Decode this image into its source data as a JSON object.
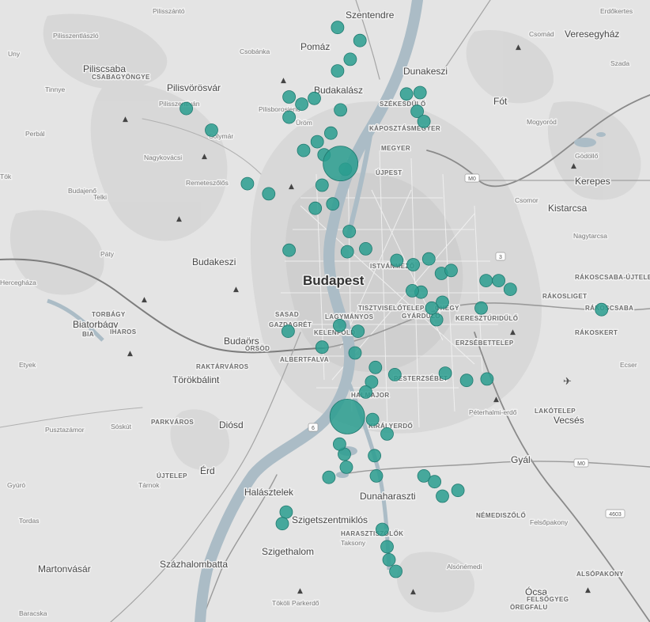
{
  "map": {
    "marker_color": "#2a9d8f",
    "water_color": "#abbcc6",
    "capital": "Budapest",
    "places_major": [
      "Szentendre",
      "Pomáz",
      "Dunakeszi",
      "Budakalász",
      "Veresegyház",
      "Fót",
      "Piliscsaba",
      "Pilisvörösvár",
      "Kerepes",
      "Kistarcsa",
      "Budakeszi",
      "Biatorbágy",
      "Budaörs",
      "Törökbálint",
      "Diósd",
      "Érd",
      "Vecsés",
      "Gyál",
      "Halásztelek",
      "Dunaharaszti",
      "Szigetszentmiklós",
      "Szigethalom",
      "Martonvásár",
      "Százhalombatta",
      "Ócsa"
    ],
    "places_minor": [
      "Pilisszántó",
      "Pilisszentlászló",
      "Pilisborosjenő",
      "Üröm",
      "Solymár",
      "Nagykovácsi",
      "Remeteszőlős",
      "Budajenő",
      "Telki",
      "Páty",
      "Perbál",
      "Tök",
      "Uny",
      "Tinnye",
      "Pilisszentiván",
      "Csobánka",
      "Csomád",
      "Erdőkertes",
      "Szada",
      "Mogyoród",
      "Gödöllő",
      "Csomor",
      "Nagytarcsa",
      "Ecser",
      "Felsőpakony",
      "Alsónémedi",
      "Taksony",
      "Tárnok",
      "Sóskút",
      "Pusztazámor",
      "Etyek",
      "Gyúró",
      "Tordas",
      "Baracska",
      "Hercegháza",
      "Szada Gödöllői Tájvédelmi Körzet",
      "Tököli Parkerdő",
      "Péterhalmi-erdő"
    ],
    "districts": [
      "SZÉKESDŰLŐ",
      "KÁPOSZTÁSMEGYER",
      "MEGYER",
      "ÚJPEST",
      "ISTVÁNMEZŐ",
      "TISZTVISELŐTELEP",
      "GYÁRDŰLŐ",
      "ÓHEGY",
      "KERESZTÚRIDŰLŐ",
      "ERZSÉBETTELEP",
      "PESTERZSÉBET",
      "SZABADSÁGHEGY",
      "LAGYMÁNYOS",
      "SASAD",
      "GAZDAGRÉT",
      "KELENFÖLD",
      "ALBERTFALVA",
      "RAKTÁRVÁROS",
      "PARKVÁROS",
      "ÚJTELEP",
      "ÖRSÖD",
      "KIRÁLYERDŐ",
      "CSEPEL",
      "HALMAJOR",
      "RÁKOSCSABA-ÚJTELEP",
      "RÁKOSLIGET",
      "RÁKOSCSABA",
      "RÁKOSKERT",
      "LAKÓTELEP",
      "NÉMEDISZŐLŐ",
      "HARASZTISZŐLŐK",
      "ALSÓPAKONY",
      "ÖREGFALU",
      "FELSŐGYEG",
      "TORBÁGY",
      "BIA",
      "IHAROS",
      "CSABAGYÖNGYE",
      "Budakeszi erdő"
    ],
    "road_shields": [
      "M0",
      "M0",
      "3",
      "6",
      "4603"
    ],
    "markers": [
      {
        "lat": 47.611,
        "lon": 19.098,
        "size": 1
      },
      {
        "lat": 47.602,
        "lon": 19.121,
        "size": 1
      },
      {
        "lat": 47.589,
        "lon": 19.111,
        "size": 1
      },
      {
        "lat": 47.581,
        "lon": 19.098,
        "size": 1
      },
      {
        "lat": 47.563,
        "lon": 19.048,
        "size": 1
      },
      {
        "lat": 47.562,
        "lon": 19.074,
        "size": 1
      },
      {
        "lat": 47.558,
        "lon": 19.061,
        "size": 1
      },
      {
        "lat": 47.549,
        "lon": 19.048,
        "size": 1
      },
      {
        "lat": 47.554,
        "lon": 19.101,
        "size": 1
      },
      {
        "lat": 47.538,
        "lon": 19.091,
        "size": 1
      },
      {
        "lat": 47.532,
        "lon": 19.077,
        "size": 1
      },
      {
        "lat": 47.523,
        "lon": 19.084,
        "size": 1
      },
      {
        "lat": 47.513,
        "lon": 19.106,
        "size": 1
      },
      {
        "lat": 47.526,
        "lon": 19.063,
        "size": 1
      },
      {
        "lat": 47.517,
        "lon": 19.101,
        "size": 4
      },
      {
        "lat": 47.565,
        "lon": 19.169,
        "size": 1
      },
      {
        "lat": 47.566,
        "lon": 19.183,
        "size": 1
      },
      {
        "lat": 47.553,
        "lon": 19.18,
        "size": 1
      },
      {
        "lat": 47.546,
        "lon": 19.187,
        "size": 1
      },
      {
        "lat": 47.502,
        "lon": 19.082,
        "size": 1
      },
      {
        "lat": 47.489,
        "lon": 19.093,
        "size": 1
      },
      {
        "lat": 47.503,
        "lon": 19.005,
        "size": 1
      },
      {
        "lat": 47.496,
        "lon": 19.027,
        "size": 1
      },
      {
        "lat": 47.486,
        "lon": 19.075,
        "size": 1
      },
      {
        "lat": 47.47,
        "lon": 19.11,
        "size": 1
      },
      {
        "lat": 47.457,
        "lon": 19.048,
        "size": 1
      },
      {
        "lat": 47.458,
        "lon": 19.127,
        "size": 1
      },
      {
        "lat": 47.456,
        "lon": 19.108,
        "size": 1
      },
      {
        "lat": 47.451,
        "lon": 19.192,
        "size": 1
      },
      {
        "lat": 47.45,
        "lon": 19.159,
        "size": 1
      },
      {
        "lat": 47.447,
        "lon": 19.176,
        "size": 1
      },
      {
        "lat": 47.441,
        "lon": 19.205,
        "size": 1
      },
      {
        "lat": 47.428,
        "lon": 19.184,
        "size": 1
      },
      {
        "lat": 47.443,
        "lon": 19.215,
        "size": 1
      },
      {
        "lat": 47.436,
        "lon": 19.251,
        "size": 1
      },
      {
        "lat": 47.436,
        "lon": 19.264,
        "size": 1
      },
      {
        "lat": 47.43,
        "lon": 19.276,
        "size": 1
      },
      {
        "lat": 47.429,
        "lon": 19.175,
        "size": 1
      },
      {
        "lat": 47.421,
        "lon": 19.206,
        "size": 1
      },
      {
        "lat": 47.417,
        "lon": 19.195,
        "size": 1
      },
      {
        "lat": 47.417,
        "lon": 19.246,
        "size": 1
      },
      {
        "lat": 47.409,
        "lon": 19.2,
        "size": 1
      },
      {
        "lat": 47.416,
        "lon": 19.37,
        "size": 1
      },
      {
        "lat": 47.405,
        "lon": 19.1,
        "size": 1
      },
      {
        "lat": 47.401,
        "lon": 19.047,
        "size": 1
      },
      {
        "lat": 47.401,
        "lon": 19.119,
        "size": 1
      },
      {
        "lat": 47.39,
        "lon": 19.082,
        "size": 1
      },
      {
        "lat": 47.386,
        "lon": 19.116,
        "size": 1
      },
      {
        "lat": 47.376,
        "lon": 19.137,
        "size": 1
      },
      {
        "lat": 47.366,
        "lon": 19.133,
        "size": 1
      },
      {
        "lat": 47.371,
        "lon": 19.157,
        "size": 1
      },
      {
        "lat": 47.367,
        "lon": 19.231,
        "size": 1
      },
      {
        "lat": 47.368,
        "lon": 19.252,
        "size": 1
      },
      {
        "lat": 47.359,
        "lon": 19.127,
        "size": 1
      },
      {
        "lat": 47.372,
        "lon": 19.209,
        "size": 1
      },
      {
        "lat": 47.34,
        "lon": 19.134,
        "size": 1
      },
      {
        "lat": 47.33,
        "lon": 19.149,
        "size": 1
      },
      {
        "lat": 47.316,
        "lon": 19.105,
        "size": 1
      },
      {
        "lat": 47.315,
        "lon": 19.136,
        "size": 1
      },
      {
        "lat": 47.307,
        "lon": 19.107,
        "size": 1
      },
      {
        "lat": 47.301,
        "lon": 19.138,
        "size": 1
      },
      {
        "lat": 47.3,
        "lon": 19.089,
        "size": 1
      },
      {
        "lat": 47.342,
        "lon": 19.108,
        "size": 4
      },
      {
        "lat": 47.323,
        "lon": 19.1,
        "size": 1
      },
      {
        "lat": 47.301,
        "lon": 19.187,
        "size": 1
      },
      {
        "lat": 47.297,
        "lon": 19.198,
        "size": 1
      },
      {
        "lat": 47.291,
        "lon": 19.222,
        "size": 1
      },
      {
        "lat": 47.287,
        "lon": 19.206,
        "size": 1
      },
      {
        "lat": 47.276,
        "lon": 19.045,
        "size": 1
      },
      {
        "lat": 47.268,
        "lon": 19.041,
        "size": 1
      },
      {
        "lat": 47.264,
        "lon": 19.144,
        "size": 1
      },
      {
        "lat": 47.252,
        "lon": 19.149,
        "size": 1
      },
      {
        "lat": 47.243,
        "lon": 19.151,
        "size": 1
      },
      {
        "lat": 47.235,
        "lon": 19.158,
        "size": 1
      },
      {
        "lat": 47.555,
        "lon": 18.942,
        "size": 1
      },
      {
        "lat": 47.54,
        "lon": 18.968,
        "size": 1
      }
    ]
  }
}
